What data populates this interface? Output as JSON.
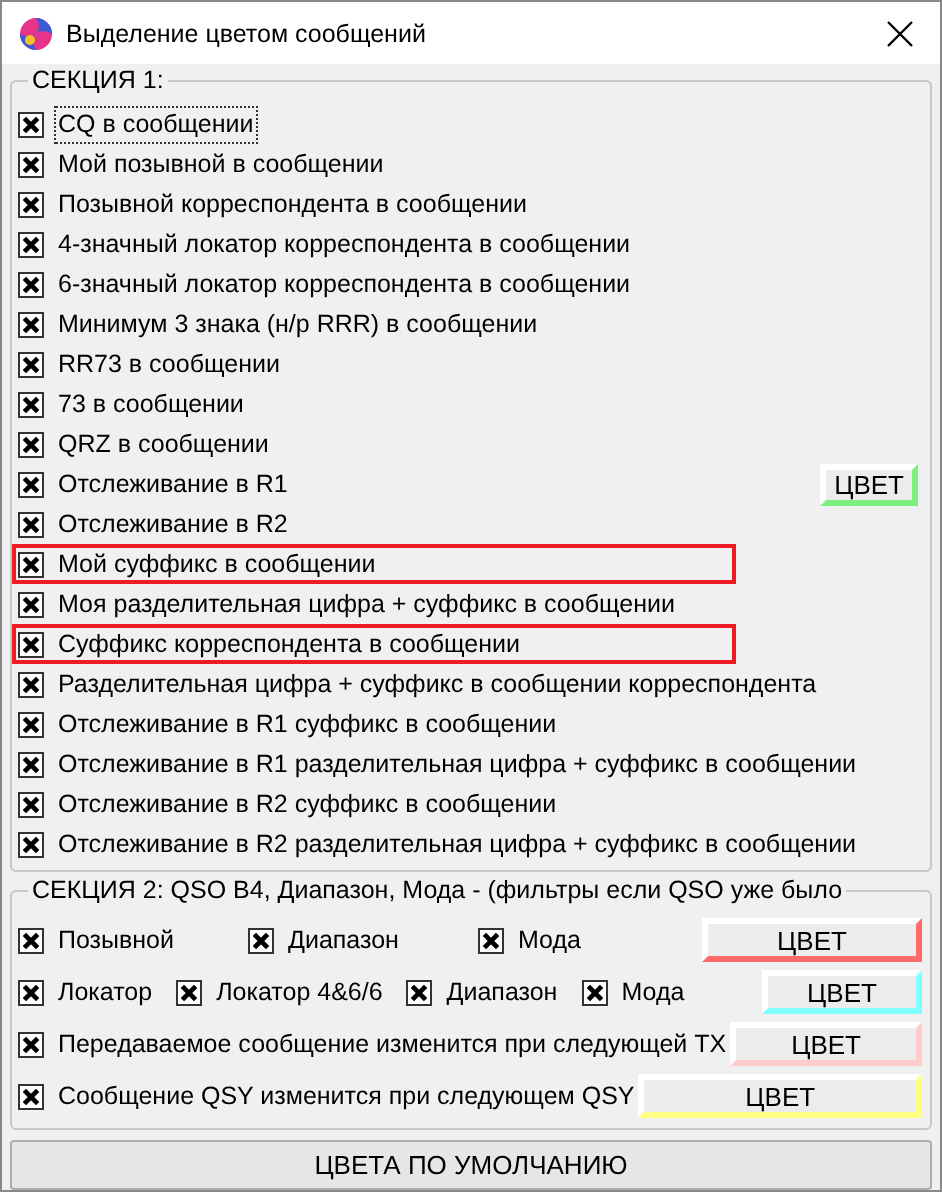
{
  "window": {
    "title": "Выделение цветом сообщений"
  },
  "section1": {
    "legend": "СЕКЦИЯ 1:",
    "items": [
      {
        "label": "CQ в сообщении",
        "checked": true,
        "focused": true,
        "highlighted": false
      },
      {
        "label": "Мой позывной в сообщении",
        "checked": true,
        "focused": false,
        "highlighted": false
      },
      {
        "label": "Позывной корреспондента в сообщении",
        "checked": true,
        "focused": false,
        "highlighted": false
      },
      {
        "label": "4-значный локатор корреспондента в сообщении",
        "checked": true,
        "focused": false,
        "highlighted": false
      },
      {
        "label": "6-значный локатор корреспондента в сообщении",
        "checked": true,
        "focused": false,
        "highlighted": false
      },
      {
        "label": "Минимум 3 знака (н/р RRR) в сообщении",
        "checked": true,
        "focused": false,
        "highlighted": false
      },
      {
        "label": "RR73 в сообщении",
        "checked": true,
        "focused": false,
        "highlighted": false
      },
      {
        "label": "73 в сообщении",
        "checked": true,
        "focused": false,
        "highlighted": false
      },
      {
        "label": "QRZ в сообщении",
        "checked": true,
        "focused": false,
        "highlighted": false
      },
      {
        "label": "Отслеживание в R1",
        "checked": true,
        "focused": false,
        "highlighted": false,
        "color_button": {
          "label": "ЦВЕТ",
          "color": "#7cf07c"
        }
      },
      {
        "label": "Отслеживание в R2",
        "checked": true,
        "focused": false,
        "highlighted": false
      },
      {
        "label": "Мой суффикс в сообщении",
        "checked": true,
        "focused": false,
        "highlighted": true
      },
      {
        "label": "Моя разделительная цифра + суффикс в сообщении",
        "checked": true,
        "focused": false,
        "highlighted": false
      },
      {
        "label": "Суффикс корреспондента в сообщении",
        "checked": true,
        "focused": false,
        "highlighted": true
      },
      {
        "label": "Разделительная цифра + суффикс в сообщении корреспондента",
        "checked": true,
        "focused": false,
        "highlighted": false
      },
      {
        "label": "Отслеживание в R1 суффикс в сообщении",
        "checked": true,
        "focused": false,
        "highlighted": false
      },
      {
        "label": "Отслеживание в R1 разделительная цифра + суффикс в сообщении",
        "checked": true,
        "focused": false,
        "highlighted": false
      },
      {
        "label": "Отслеживание в R2 суффикс в сообщении",
        "checked": true,
        "focused": false,
        "highlighted": false
      },
      {
        "label": "Отслеживание в R2 разделительная цифра + суффикс в сообщении",
        "checked": true,
        "focused": false,
        "highlighted": false
      }
    ]
  },
  "section2": {
    "legend": "СЕКЦИЯ 2: QSO B4, Диапазон, Мода - (фильтры если QSO уже было",
    "rows": [
      {
        "checkboxes": [
          {
            "label": "Позывной",
            "checked": true
          },
          {
            "label": "Диапазон",
            "checked": true
          },
          {
            "label": "Мода",
            "checked": true
          }
        ],
        "color_button": {
          "label": "ЦВЕТ",
          "color": "#ff6b6b"
        }
      },
      {
        "checkboxes": [
          {
            "label": "Локатор",
            "checked": true
          },
          {
            "label": "Локатор 4&6/6",
            "checked": true
          },
          {
            "label": "Диапазон",
            "checked": true
          },
          {
            "label": "Мода",
            "checked": true
          }
        ],
        "color_button": {
          "label": "ЦВЕТ",
          "color": "#80ffff"
        }
      },
      {
        "checkboxes": [
          {
            "label": "Передаваемое сообщение изменится при следующей TX",
            "checked": true
          }
        ],
        "color_button": {
          "label": "ЦВЕТ",
          "color": "#ffcccc"
        }
      },
      {
        "checkboxes": [
          {
            "label": "Сообщение QSY изменится при следующем QSY",
            "checked": true
          }
        ],
        "color_button": {
          "label": "ЦВЕТ",
          "color": "#ffff80"
        }
      }
    ]
  },
  "default_button": "ЦВЕТА ПО УМОЛЧАНИЮ"
}
